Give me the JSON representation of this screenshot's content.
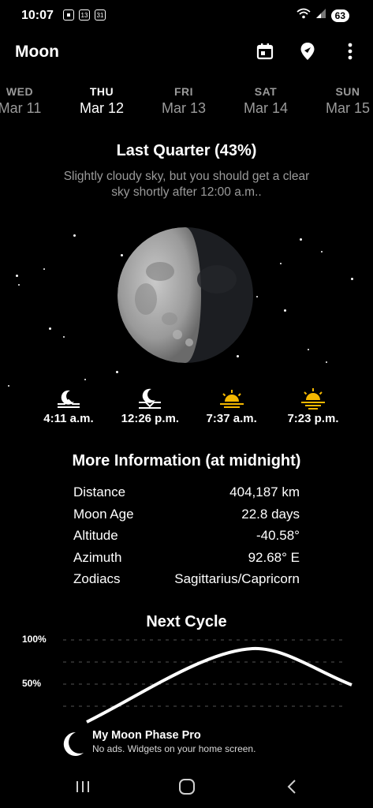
{
  "status": {
    "time": "10:07",
    "icons": [
      "screenshot-icon",
      "calendar-13-icon",
      "calendar-31-icon"
    ],
    "notif_a": "13",
    "notif_b": "31",
    "battery": "63"
  },
  "appbar": {
    "title": "Moon",
    "actions": [
      "calendar-icon",
      "location-pin-icon",
      "more-vert-icon"
    ]
  },
  "days": [
    {
      "name": "WED",
      "date": "Mar 11",
      "active": false
    },
    {
      "name": "THU",
      "date": "Mar 12",
      "active": true
    },
    {
      "name": "FRI",
      "date": "Mar 13",
      "active": false
    },
    {
      "name": "SAT",
      "date": "Mar 14",
      "active": false
    },
    {
      "name": "SUN",
      "date": "Mar 15",
      "active": false
    }
  ],
  "phase": {
    "title": "Last Quarter (43%)",
    "description": "Slightly cloudy sky, but you should get a clear sky shortly after 12:00 a.m.."
  },
  "riseset": [
    {
      "icon": "moonrise-icon",
      "time": "4:11 a.m."
    },
    {
      "icon": "moonset-icon",
      "time": "12:26 p.m."
    },
    {
      "icon": "sunrise-icon",
      "time": "7:37 a.m."
    },
    {
      "icon": "sunset-icon",
      "time": "7:23 p.m."
    }
  ],
  "info": {
    "title": "More Information (at midnight)",
    "rows": [
      {
        "label": "Distance",
        "value": "404,187 km"
      },
      {
        "label": "Moon Age",
        "value": "22.8 days"
      },
      {
        "label": "Altitude",
        "value": "-40.58°"
      },
      {
        "label": "Azimuth",
        "value": "92.68° E"
      },
      {
        "label": "Zodiacs",
        "value": "Sagittarius/Capricorn"
      }
    ]
  },
  "cycle": {
    "title": "Next Cycle",
    "y_labels": [
      "100%",
      "50%"
    ]
  },
  "promo": {
    "title": "My Moon Phase Pro",
    "subtitle": "No ads. Widgets on your home screen."
  },
  "colors": {
    "accent_sun": "#f5b800",
    "muted_text": "#9a9a9a",
    "background": "#000000"
  }
}
